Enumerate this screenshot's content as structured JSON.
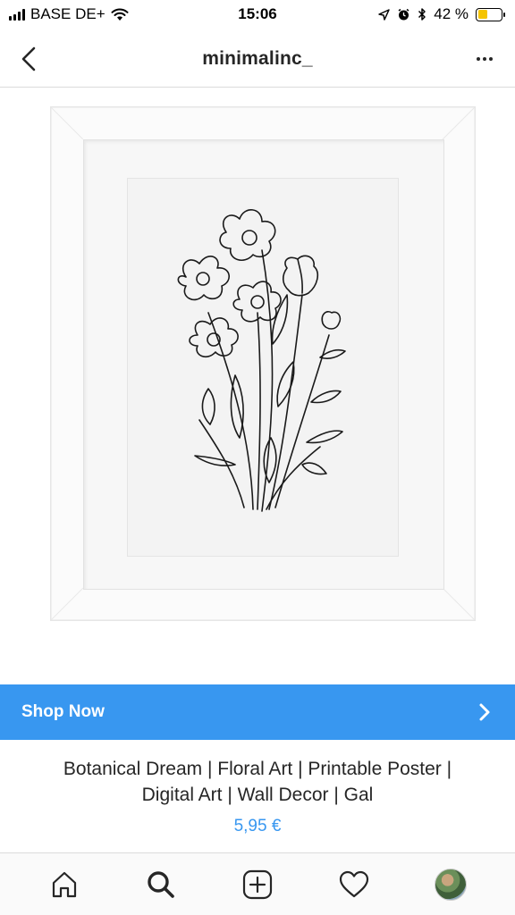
{
  "status_bar": {
    "carrier": "BASE DE+",
    "time": "15:06",
    "battery_percent": "42 %",
    "battery_level": 0.42
  },
  "header": {
    "title": "minimalinc_"
  },
  "image": {
    "alt": "Framed botanical line drawing of poppies"
  },
  "shop": {
    "label": "Shop Now"
  },
  "product": {
    "title_line1": "Botanical Dream | Floral Art | Printable Poster |",
    "title_line2": "Digital Art | Wall Decor | Gal",
    "price": "5,95 €"
  },
  "colors": {
    "accent": "#3897f0",
    "text": "#262626",
    "battery": "#f5c400"
  },
  "tab_bar": {
    "items": [
      "home-icon",
      "search-icon",
      "add-post-icon",
      "activity-heart-icon",
      "profile-avatar"
    ]
  }
}
